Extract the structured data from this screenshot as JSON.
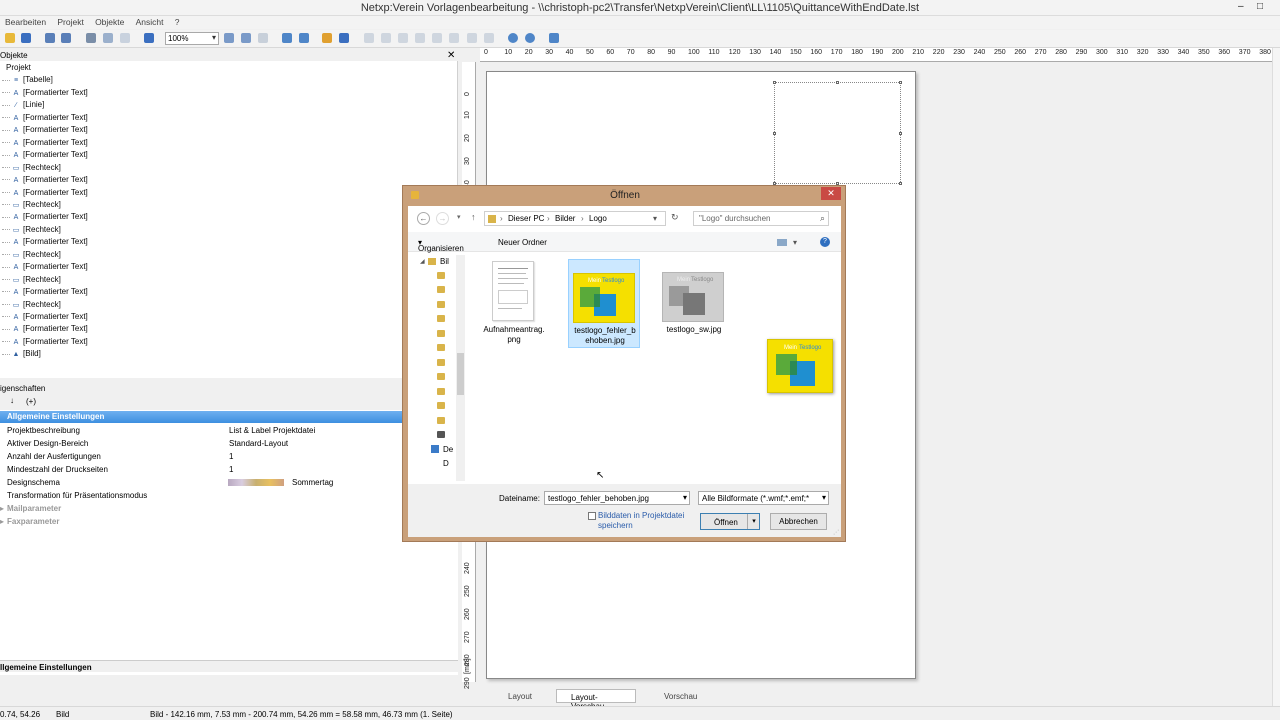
{
  "window": {
    "title": "Netxp:Verein Vorlagenbearbeitung - \\\\christoph-pc2\\Transfer\\NetxpVerein\\Client\\LL\\1105\\QuittanceWithEndDate.lst",
    "min_glyph": "–",
    "max_glyph": "□",
    "close_glyph": "✕"
  },
  "menu": [
    "Bearbeiten",
    "Projekt",
    "Objekte",
    "Ansicht",
    "?"
  ],
  "toolbar": {
    "zoom": "100%"
  },
  "objects_panel": {
    "title": "Objekte",
    "close_glyph": "✕",
    "items": [
      {
        "label": "Projekt",
        "icon": ""
      },
      {
        "label": "[Tabelle]",
        "icon": "≡"
      },
      {
        "label": "[Formatierter Text]",
        "icon": "A"
      },
      {
        "label": "[Linie]",
        "icon": "∕"
      },
      {
        "label": "[Formatierter Text]",
        "icon": "A"
      },
      {
        "label": "[Formatierter Text]",
        "icon": "A"
      },
      {
        "label": "[Formatierter Text]",
        "icon": "A"
      },
      {
        "label": "[Formatierter Text]",
        "icon": "A"
      },
      {
        "label": "[Rechteck]",
        "icon": "▭"
      },
      {
        "label": "[Formatierter Text]",
        "icon": "A"
      },
      {
        "label": "[Formatierter Text]",
        "icon": "A"
      },
      {
        "label": "[Rechteck]",
        "icon": "▭"
      },
      {
        "label": "[Formatierter Text]",
        "icon": "A"
      },
      {
        "label": "[Rechteck]",
        "icon": "▭"
      },
      {
        "label": "[Formatierter Text]",
        "icon": "A"
      },
      {
        "label": "[Rechteck]",
        "icon": "▭"
      },
      {
        "label": "[Formatierter Text]",
        "icon": "A"
      },
      {
        "label": "[Rechteck]",
        "icon": "▭"
      },
      {
        "label": "[Formatierter Text]",
        "icon": "A"
      },
      {
        "label": "[Rechteck]",
        "icon": "▭"
      },
      {
        "label": "[Formatierter Text]",
        "icon": "A"
      },
      {
        "label": "[Formatierter Text]",
        "icon": "A"
      },
      {
        "label": "[Formatierter Text]",
        "icon": "A"
      },
      {
        "label": "[Bild]",
        "icon": "▲"
      }
    ]
  },
  "properties_panel": {
    "title": "igenschaften",
    "group": "Allgemeine Einstellungen",
    "rows": [
      {
        "key": "Projektbeschreibung",
        "value": "List & Label Projektdatei"
      },
      {
        "key": "Aktiver Design-Bereich",
        "value": "Standard-Layout"
      },
      {
        "key": "Anzahl der Ausfertigungen",
        "value": "1"
      },
      {
        "key": "Mindestzahl der Druckseiten",
        "value": "1"
      },
      {
        "key": "Designschema",
        "value": "Sommertag"
      },
      {
        "key": "Transformation für Präsentationsmodus",
        "value": ""
      }
    ],
    "collapsed": [
      "Mailparameter",
      "Faxparameter"
    ],
    "footer": "llgemeine Einstellungen",
    "sort_label": "(+)"
  },
  "ruler": {
    "top": [
      "0",
      "10",
      "20",
      "30",
      "40",
      "50",
      "60",
      "70",
      "80",
      "90",
      "100",
      "110",
      "120",
      "130",
      "140",
      "150",
      "160",
      "170",
      "180",
      "190",
      "200",
      "210",
      "220",
      "230",
      "240",
      "250",
      "260",
      "270",
      "280",
      "290",
      "300",
      "310",
      "320",
      "330",
      "340",
      "350",
      "360",
      "370",
      "380"
    ],
    "left_top": [
      "0",
      "10",
      "20",
      "30",
      "40",
      "50"
    ],
    "left_bottom": [
      "240",
      "250",
      "260",
      "270",
      "280",
      "290"
    ],
    "unit": "[mm]"
  },
  "view_tabs": [
    "Layout",
    "Layout-Vorschau",
    "Vorschau"
  ],
  "status": {
    "coords": "0.74, 54.26",
    "object": "Bild",
    "info": "Bild - 142.16 mm, 7.53 mm - 200.74 mm, 54.26 mm = 58.58 mm, 46.73 mm (1. Seite)"
  },
  "dialog": {
    "title": "Öffnen",
    "close_glyph": "✕",
    "path": [
      "Dieser PC",
      "Bilder",
      "Logo"
    ],
    "search_placeholder": "\"Logo\" durchsuchen",
    "organize": "Organisieren",
    "new_folder": "Neuer Ordner",
    "nav_top": "Bil",
    "nav_bottom": [
      "De",
      "D"
    ],
    "files": [
      {
        "name": "Aufnahmeantrag.png",
        "line1": "Aufnahmeantrag.",
        "line2": "png"
      },
      {
        "name": "testlogo_fehler_behoben.jpg",
        "line1": "testlogo_fehler_b",
        "line2": "ehoben.jpg",
        "selected": true
      },
      {
        "name": "testlogo_sw.jpg",
        "line1": "testlogo_sw.jpg",
        "line2": ""
      }
    ],
    "logo_text_a": "Mein",
    "logo_text_b": "Testlogo",
    "filename_label": "Dateiname:",
    "filename_value": "testlogo_fehler_behoben.jpg",
    "filter_value": "Alle Bildformate (*.wmf;*.emf;*",
    "embed_label_1": "Bilddaten in Projektdatei",
    "embed_label_2": "speichern",
    "open_label": "Öffnen",
    "cancel_label": "Abbrechen"
  }
}
